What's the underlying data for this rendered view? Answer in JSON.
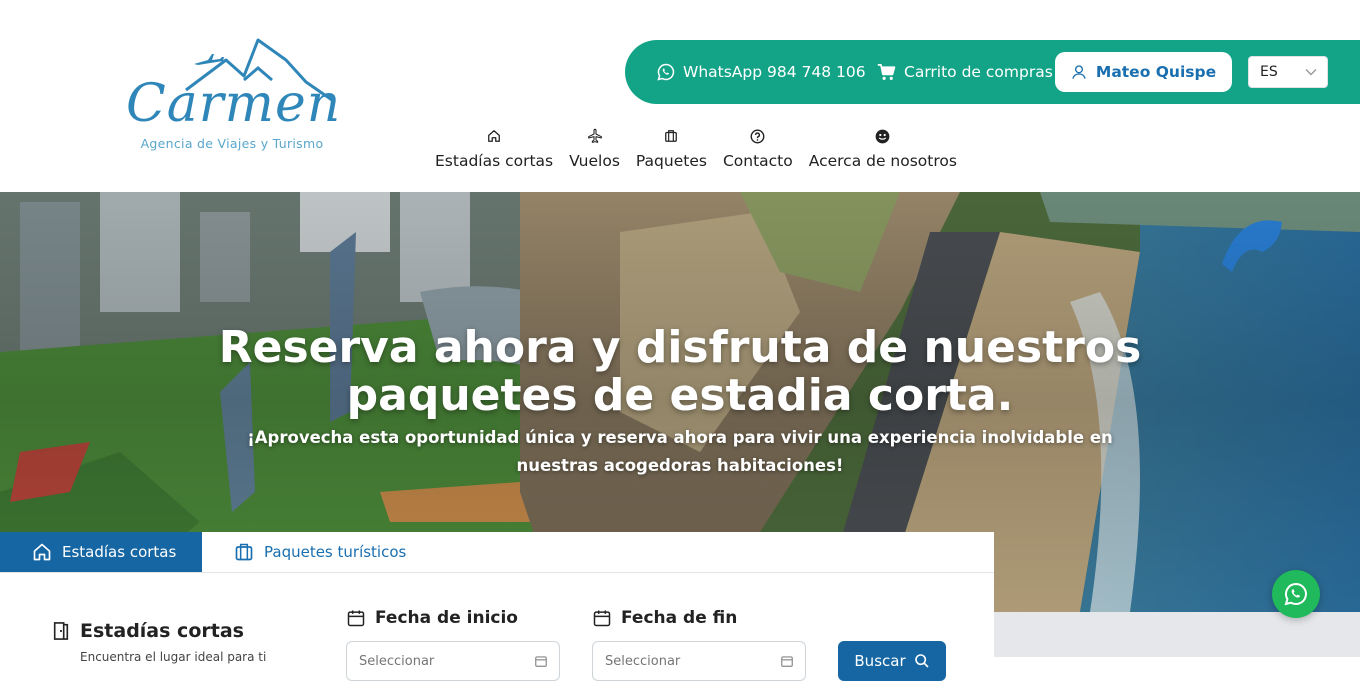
{
  "brand": {
    "name": "Carmen",
    "tagline": "Agencia de Viajes y Turismo"
  },
  "topbar": {
    "whatsapp_label": "WhatsApp 984 748 106",
    "cart_label": "Carrito de compras",
    "user_name": "Mateo Quispe",
    "language": "ES",
    "accent_color": "#13a487"
  },
  "nav": {
    "items": [
      {
        "label": "Estadías cortas",
        "icon": "home-icon"
      },
      {
        "label": "Vuelos",
        "icon": "plane-icon"
      },
      {
        "label": "Paquetes",
        "icon": "suitcase-icon"
      },
      {
        "label": "Contacto",
        "icon": "question-circle-icon"
      },
      {
        "label": "Acerca de nosotros",
        "icon": "smile-icon"
      }
    ]
  },
  "hero": {
    "title": "Reserva ahora y disfruta de nuestros paquetes de estadia corta.",
    "subtitle": "¡Aprovecha esta oportunidad única y reserva ahora para vivir una experiencia inolvidable en nuestras acogedoras habitaciones!"
  },
  "search": {
    "tabs": [
      {
        "label": "Estadías cortas",
        "active": true
      },
      {
        "label": "Paquetes turísticos",
        "active": false
      }
    ],
    "section_title": "Estadías cortas",
    "section_desc": "Encuentra el lugar ideal para ti",
    "start_label": "Fecha de inicio",
    "end_label": "Fecha de fin",
    "start_placeholder": "Seleccionar",
    "end_placeholder": "Seleccionar",
    "button_label": "Buscar",
    "primary_color": "#1566a3"
  }
}
